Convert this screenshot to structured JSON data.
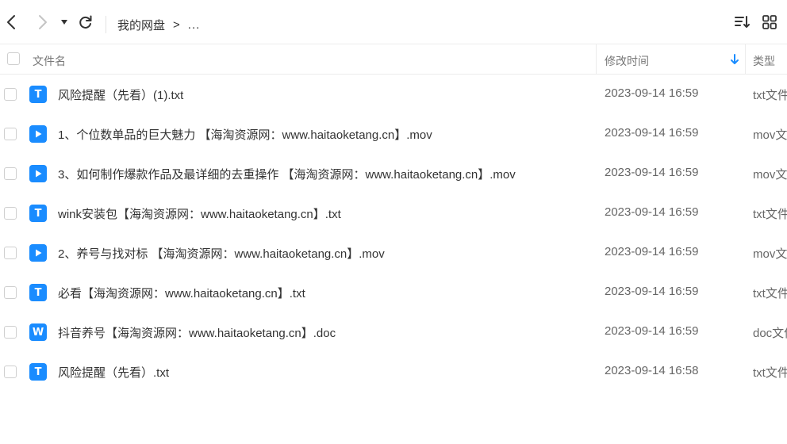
{
  "toolbar": {
    "back_icon": "chevron-left-icon",
    "forward_icon": "chevron-right-icon",
    "dropdown_icon": "caret-down-icon",
    "refresh_icon": "refresh-icon",
    "sort_icon": "sort-list-icon",
    "grid_icon": "grid-view-icon"
  },
  "breadcrumb": {
    "root": "我的网盘",
    "separator": ">",
    "more": "..."
  },
  "table_header": {
    "name": "文件名",
    "modified": "修改时间",
    "type": "类型",
    "sort_direction": "descending"
  },
  "colors": {
    "accent": "#1a8cff",
    "border": "#ececec",
    "text": "#333333",
    "muted": "#666666"
  },
  "files": [
    {
      "icon": "T",
      "icon_name": "text-file-icon",
      "name": "风险提醒（先看）(1).txt",
      "modified": "2023-09-14 16:59",
      "type": "txt文件"
    },
    {
      "icon": "play",
      "icon_name": "video-file-icon",
      "name": "1、个位数单品的巨大魅力 【海淘资源网：www.haitaoketang.cn】.mov",
      "modified": "2023-09-14 16:59",
      "type": "mov文件"
    },
    {
      "icon": "play",
      "icon_name": "video-file-icon",
      "name": "3、如何制作爆款作品及最详细的去重操作 【海淘资源网：www.haitaoketang.cn】.mov",
      "modified": "2023-09-14 16:59",
      "type": "mov文件"
    },
    {
      "icon": "T",
      "icon_name": "text-file-icon",
      "name": "wink安装包【海淘资源网：www.haitaoketang.cn】.txt",
      "modified": "2023-09-14 16:59",
      "type": "txt文件"
    },
    {
      "icon": "play",
      "icon_name": "video-file-icon",
      "name": "2、养号与找对标 【海淘资源网：www.haitaoketang.cn】.mov",
      "modified": "2023-09-14 16:59",
      "type": "mov文件"
    },
    {
      "icon": "T",
      "icon_name": "text-file-icon",
      "name": "必看【海淘资源网：www.haitaoketang.cn】.txt",
      "modified": "2023-09-14 16:59",
      "type": "txt文件"
    },
    {
      "icon": "W",
      "icon_name": "word-file-icon",
      "name": "抖音养号【海淘资源网：www.haitaoketang.cn】.doc",
      "modified": "2023-09-14 16:59",
      "type": "doc文件"
    },
    {
      "icon": "T",
      "icon_name": "text-file-icon",
      "name": "风险提醒（先看）.txt",
      "modified": "2023-09-14 16:58",
      "type": "txt文件"
    }
  ]
}
